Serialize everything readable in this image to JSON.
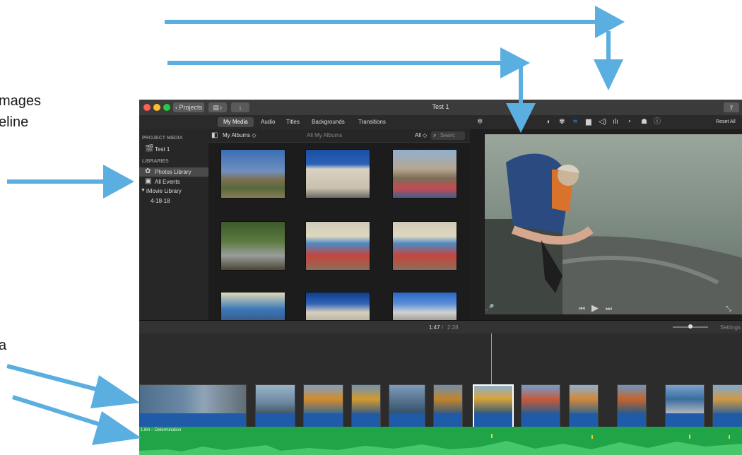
{
  "annotations": [
    "mages",
    "eline",
    "a"
  ],
  "window": {
    "title": "Test 1",
    "projects_label": "Projects",
    "reset_label": "Reset All"
  },
  "tabs": [
    "My Media",
    "Audio",
    "Titles",
    "Backgrounds",
    "Transitions"
  ],
  "active_tab": "My Media",
  "sidebar": {
    "project_media_heading": "PROJECT MEDIA",
    "project_item": "Test 1",
    "libraries_heading": "LIBRARIES",
    "items": [
      {
        "label": "Photos Library",
        "selected": true,
        "icon": "photos-icon"
      },
      {
        "label": "All Events",
        "selected": false,
        "icon": "events-icon"
      },
      {
        "label": "iMovie Library",
        "selected": false,
        "icon": "disclosure-icon"
      },
      {
        "label": "4-18-18",
        "selected": false,
        "icon": ""
      }
    ]
  },
  "browser": {
    "album_selector": "My Albums ◇",
    "breadcrumb": "All My Albums",
    "filter": "All ◇",
    "search_placeholder": "Searc"
  },
  "timeline": {
    "current_time": "1:47",
    "separator": "/",
    "total_time": "2:28",
    "settings_label": "Settings",
    "audio_label": "1.8m – Determination"
  },
  "colors": {
    "annotation_arrow": "#5aaee0",
    "audio_track": "#1fa447",
    "clip_bar": "#1f5ba8",
    "selection": "#4a4a4a"
  }
}
